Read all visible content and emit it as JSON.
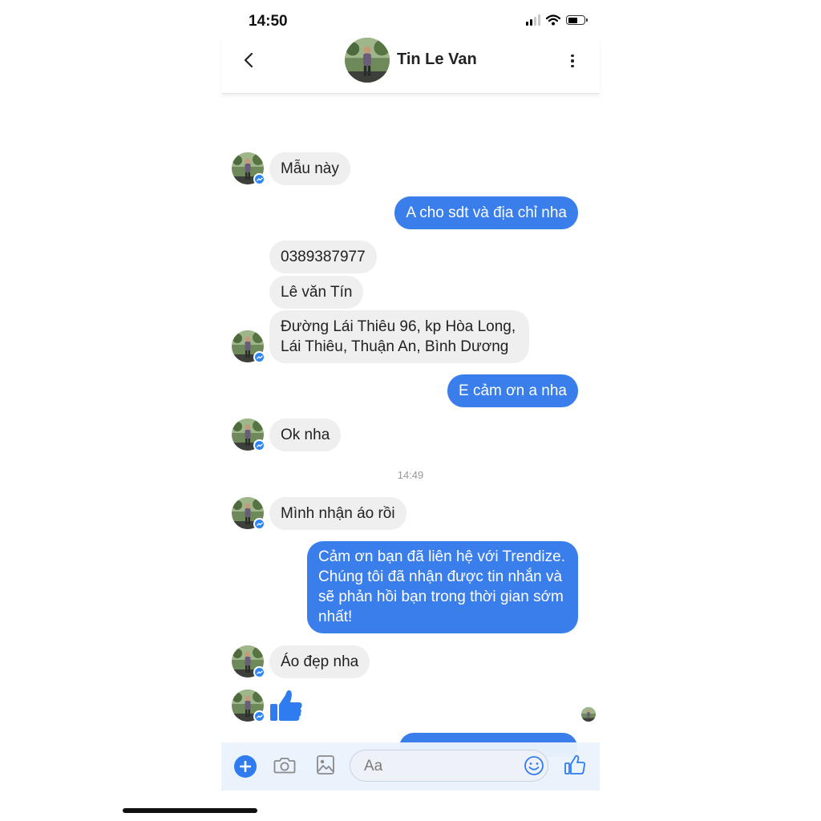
{
  "status": {
    "time": "14:50"
  },
  "header": {
    "contact_name": "Tin Le Van"
  },
  "messages": [
    {
      "text": "Mẫu này"
    },
    {
      "text": "A cho sdt và địa chỉ nha"
    },
    {
      "text": "0389387977"
    },
    {
      "text": "Lê văn Tín"
    },
    {
      "text": "Đường Lái Thiêu 96, kp Hòa Long,",
      "text2": "Lái Thiêu, Thuận An, Bình Dương"
    },
    {
      "text": "E cảm ơn a nha"
    },
    {
      "text": "Ok nha"
    },
    {
      "text": "Mình nhận áo rồi"
    },
    {
      "text": "Cảm ơn bạn đã liên hệ với Trendize.",
      "text2": "Chúng tôi đã nhận được tin nhắn và",
      "text3": "sẽ phản hồi bạn trong thời gian sớm",
      "text4": "nhất!"
    },
    {
      "text": "Áo đẹp nha"
    }
  ],
  "timestamp": "14:49",
  "composer": {
    "placeholder": "Aa"
  },
  "icons": [
    "back-icon",
    "more-icon",
    "messenger-badge-icon",
    "thumbs-up-icon",
    "plus-icon",
    "camera-icon",
    "image-icon",
    "emoji-icon",
    "like-icon"
  ],
  "colors": {
    "outgoing": "#3a7eec",
    "incoming": "#efefef",
    "accent": "#2e7cf0"
  }
}
